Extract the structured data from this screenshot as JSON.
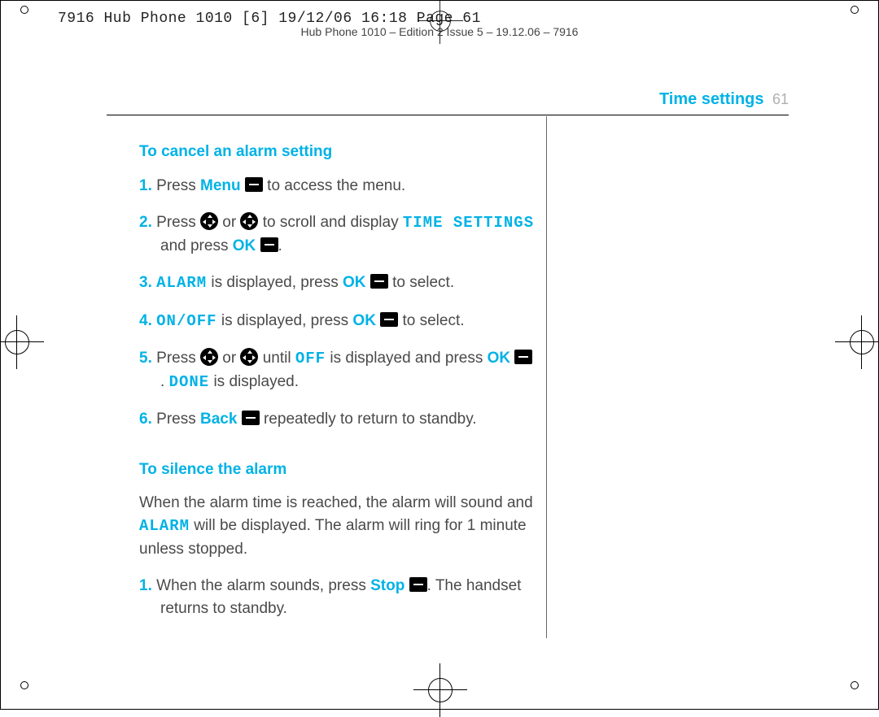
{
  "top_header": "7916 Hub Phone 1010 [6]  19/12/06  16:18  Page 61",
  "sub_header": "Hub Phone 1010 – Edition 2 Issue 5 – 19.12.06 – 7916",
  "section_title": "Time settings",
  "page_number": "61",
  "sec1": {
    "heading": "To cancel an alarm setting",
    "s1a": "1.",
    "s1b": "Press ",
    "s1c": "Menu",
    "s1d": " to access the menu.",
    "s2a": "2.",
    "s2b": "Press ",
    "s2c": " or ",
    "s2d": " to scroll and display ",
    "s2e": "TIME SETTINGS",
    "s2f": " and press ",
    "s2g": "OK",
    "s2h": ".",
    "s3a": "3.",
    "s3b": "ALARM",
    "s3c": " is displayed, press ",
    "s3d": "OK",
    "s3e": " to select.",
    "s4a": "4.",
    "s4b": "ON/OFF",
    "s4c": " is displayed, press ",
    "s4d": "OK",
    "s4e": " to select.",
    "s5a": "5.",
    "s5b": "Press ",
    "s5c": " or ",
    "s5d": " until ",
    "s5e": "OFF",
    "s5f": " is displayed and press ",
    "s5g": "OK",
    "s5h": ". ",
    "s5i": "DONE",
    "s5j": " is displayed.",
    "s6a": "6.",
    "s6b": "Press ",
    "s6c": "Back",
    "s6d": " repeatedly to return to standby."
  },
  "sec2": {
    "heading": "To silence the alarm",
    "p1a": "When the alarm time is reached, the alarm will sound and ",
    "p1b": "ALARM",
    "p1c": " will be displayed. The alarm will ring for 1 minute unless stopped.",
    "s1a": "1.",
    "s1b": "When the alarm sounds, press ",
    "s1c": "Stop",
    "s1d": ". The handset returns to standby."
  }
}
